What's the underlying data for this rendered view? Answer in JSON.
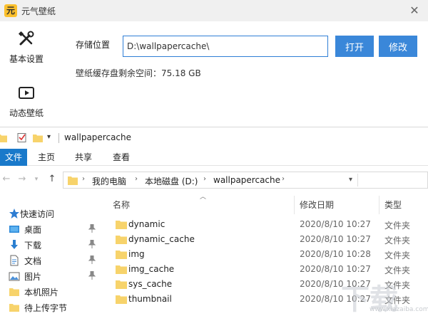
{
  "app": {
    "logo_char": "元",
    "title": "元气壁纸",
    "close_glyph": "✕",
    "nav": [
      {
        "label": "基本设置",
        "icon": "tools-icon"
      },
      {
        "label": "动态壁纸",
        "icon": "video-play-icon"
      }
    ],
    "storage_label": "存储位置",
    "path_value": "D:\\wallpapercache\\",
    "open_button": "打开",
    "edit_button": "修改",
    "space_text": "壁纸缓存盘剩余空间：75.18 GB",
    "accent_color": "#3a87d9"
  },
  "explorer": {
    "title": "wallpapercache",
    "ribbon_tabs": [
      "文件",
      "主页",
      "共享",
      "查看"
    ],
    "breadcrumbs": [
      "我的电脑",
      "本地磁盘 (D:)",
      "wallpapercache"
    ],
    "sidebar": [
      {
        "label": "快速访问",
        "icon": "star-icon"
      },
      {
        "label": "桌面",
        "icon": "desktop-icon"
      },
      {
        "label": "下载",
        "icon": "download-arrow-icon"
      },
      {
        "label": "文档",
        "icon": "document-icon"
      },
      {
        "label": "图片",
        "icon": "picture-icon"
      },
      {
        "label": "本机照片",
        "icon": "folder-icon"
      },
      {
        "label": "待上传字节",
        "icon": "folder-icon"
      }
    ],
    "columns": {
      "name": "名称",
      "date": "修改日期",
      "type": "类型"
    },
    "files": [
      {
        "name": "dynamic",
        "date": "2020/8/10 10:27",
        "type": "文件夹"
      },
      {
        "name": "dynamic_cache",
        "date": "2020/8/10 10:27",
        "type": "文件夹"
      },
      {
        "name": "img",
        "date": "2020/8/10 10:28",
        "type": "文件夹"
      },
      {
        "name": "img_cache",
        "date": "2020/8/10 10:27",
        "type": "文件夹"
      },
      {
        "name": "sys_cache",
        "date": "2020/8/10 10:27",
        "type": "文件夹"
      },
      {
        "name": "thumbnail",
        "date": "2020/8/10 10:27",
        "type": "文件夹"
      }
    ],
    "folder_color": "#f7d36b"
  },
  "watermark": {
    "text": "下载",
    "url": "www.xiazaiba.com"
  }
}
